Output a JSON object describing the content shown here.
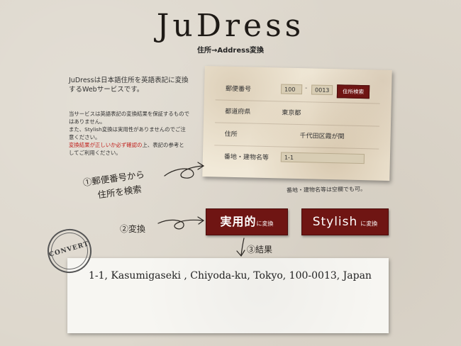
{
  "header": {
    "logo": "JuDress",
    "subtitle": "住所→Address変換"
  },
  "description": {
    "main": "JuDressは日本語住所を英語表記に変換するWebサービスです。",
    "note_1": "当サービスは英語表記の変換結果を保証するものではありません。",
    "note_2": "また、Stylish変換は実用性がありませんのでご注意ください。",
    "note_red": "変換結果が正しいか必ず確認の",
    "note_3": "上、表記の参考としてご利用ください。"
  },
  "form": {
    "postal_label": "郵便番号",
    "postal_first": "100",
    "postal_dash": "-",
    "postal_second": "0013",
    "search_button": "住所検索",
    "prefecture_label": "都道府県",
    "prefecture_value": "東京都",
    "address_label": "住所",
    "address_value": "千代田区霞が関",
    "building_label": "番地・建物名等",
    "building_value": "1-1",
    "hint": "番地・建物名等は空欄でも可。"
  },
  "annotations": {
    "step1_line1": "①郵便番号から",
    "step1_line2": "住所を検索",
    "step2": "②変換",
    "step3": "③結果"
  },
  "buttons": {
    "practical_main": "実用的",
    "practical_suffix": "に変換",
    "stylish_main": "Stylish",
    "stylish_suffix": "に変換"
  },
  "stamp": {
    "text": "CONVERT"
  },
  "result": {
    "text": "1-1, Kasumigaseki , Chiyoda-ku, Tokyo, 100-0013, Japan"
  },
  "colors": {
    "accent": "#6f1513",
    "background": "#ddd7cc",
    "card": "#f1e9d8",
    "warning_text": "#c0201c"
  }
}
